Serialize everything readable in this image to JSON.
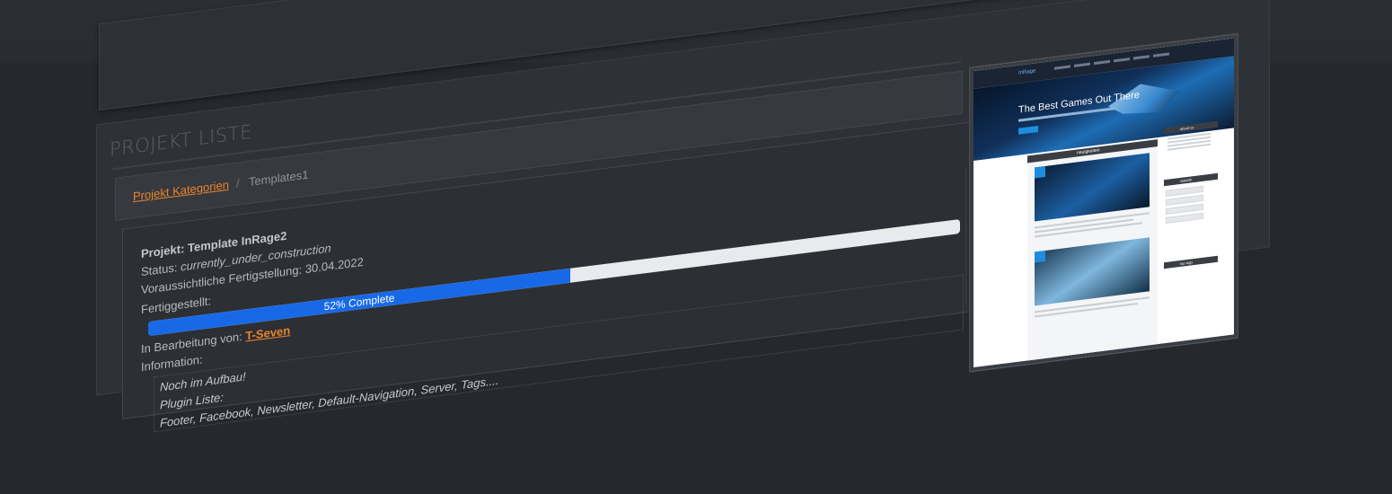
{
  "page": {
    "title": "PROJEKT LISTE"
  },
  "breadcrumb": {
    "parent": "Projekt Kategorien",
    "separator": "/",
    "current": "Templates1"
  },
  "project": {
    "title": "Projekt: Template InRage2",
    "status_label": "Status: ",
    "status_value": "currently_under_construction",
    "eta_label": "Voraussichtliche Fertigstellung: ",
    "eta_value": "30.04.2022",
    "done_label": "Fertiggestellt:",
    "progress_percent": 52,
    "progress_text": "52% Complete",
    "assignee_label": "In Bearbeitung von: ",
    "assignee": "T-Seven",
    "info_label": "Information:",
    "info_lines": [
      "Noch im Aufbau!",
      "Plugin Liste:",
      "Footer, Facebook, Newsletter, Default-Navigation, Server, Tags...."
    ]
  },
  "preview": {
    "hero_title": "The Best Games Out There",
    "section_heading": "neuigkeiten",
    "side_headings": [
      "about us",
      "statistik",
      "top tags"
    ]
  },
  "colors": {
    "accent": "#e9852c",
    "progress": "#1769e8",
    "background": "#25282d"
  }
}
